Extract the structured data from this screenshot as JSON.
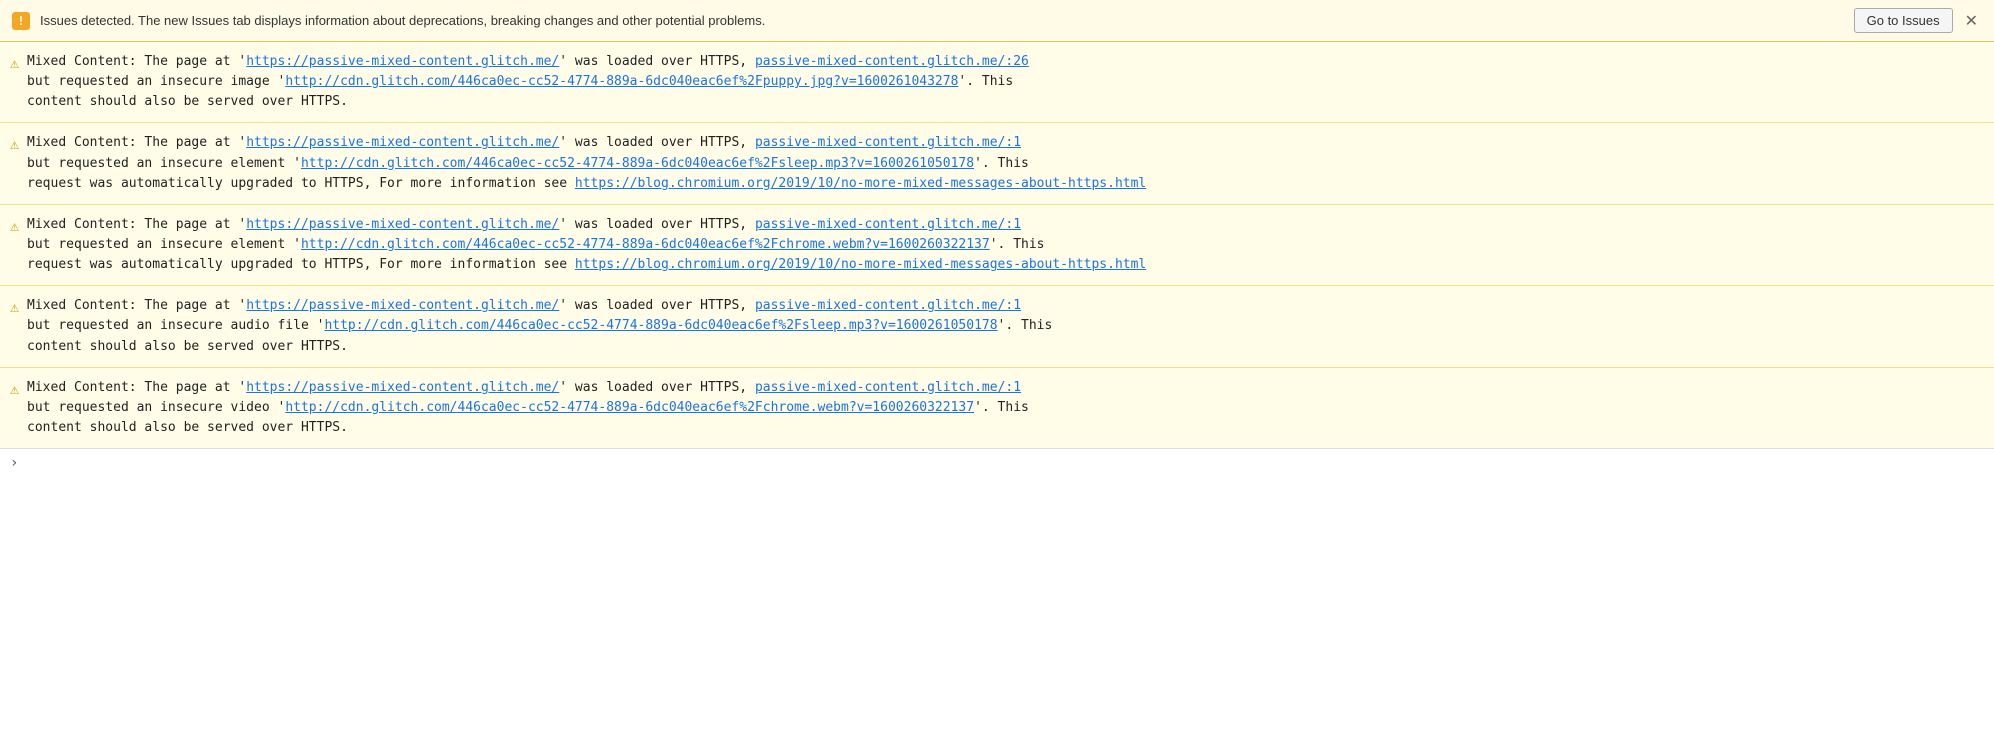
{
  "banner": {
    "icon": "!",
    "text": "Issues detected. The new Issues tab displays information about deprecations, breaking changes and other potential problems.",
    "go_to_issues_label": "Go to Issues",
    "close_label": "✕"
  },
  "messages": [
    {
      "id": 1,
      "parts": [
        {
          "type": "text",
          "value": "Mixed Content: The page at '"
        },
        {
          "type": "link",
          "value": "https://passive-mixed-content.glitch.me/",
          "href": "https://passive-mixed-content.glitch.me/"
        },
        {
          "type": "text",
          "value": "' was loaded over HTTPS,    "
        },
        {
          "type": "link",
          "value": "passive-mixed-content.glitch.me/:26",
          "href": "#"
        },
        {
          "type": "text",
          "value": "\nbut requested an insecure image '"
        },
        {
          "type": "link",
          "value": "http://cdn.glitch.com/446ca0ec-cc52-4774-889a-6dc040eac6ef%2Fpuppy.jpg?v=1600261043278",
          "href": "#"
        },
        {
          "type": "text",
          "value": "'. This\ncontent should also be served over HTTPS."
        }
      ]
    },
    {
      "id": 2,
      "parts": [
        {
          "type": "text",
          "value": "Mixed Content: The page at '"
        },
        {
          "type": "link",
          "value": "https://passive-mixed-content.glitch.me/",
          "href": "https://passive-mixed-content.glitch.me/"
        },
        {
          "type": "text",
          "value": "' was loaded over HTTPS,    "
        },
        {
          "type": "link",
          "value": "passive-mixed-content.glitch.me/:1",
          "href": "#"
        },
        {
          "type": "text",
          "value": "\nbut requested an insecure element '"
        },
        {
          "type": "link",
          "value": "http://cdn.glitch.com/446ca0ec-cc52-4774-889a-6dc040eac6ef%2Fsleep.mp3?v=1600261050178",
          "href": "#"
        },
        {
          "type": "text",
          "value": "'. This\nrequest was automatically upgraded to HTTPS, For more information see "
        },
        {
          "type": "link",
          "value": "https://blog.chromium.org/2019/10/no-more-mixed-messages-about-https.html",
          "href": "#"
        }
      ]
    },
    {
      "id": 3,
      "parts": [
        {
          "type": "text",
          "value": "Mixed Content: The page at '"
        },
        {
          "type": "link",
          "value": "https://passive-mixed-content.glitch.me/",
          "href": "https://passive-mixed-content.glitch.me/"
        },
        {
          "type": "text",
          "value": "' was loaded over HTTPS,    "
        },
        {
          "type": "link",
          "value": "passive-mixed-content.glitch.me/:1",
          "href": "#"
        },
        {
          "type": "text",
          "value": "\nbut requested an insecure element '"
        },
        {
          "type": "link",
          "value": "http://cdn.glitch.com/446ca0ec-cc52-4774-889a-6dc040eac6ef%2Fchrome.webm?v=1600260322137",
          "href": "#"
        },
        {
          "type": "text",
          "value": "'. This\nrequest was automatically upgraded to HTTPS, For more information see "
        },
        {
          "type": "link",
          "value": "https://blog.chromium.org/2019/10/no-more-mixed-messages-about-https.html",
          "href": "#"
        }
      ]
    },
    {
      "id": 4,
      "parts": [
        {
          "type": "text",
          "value": "Mixed Content: The page at '"
        },
        {
          "type": "link",
          "value": "https://passive-mixed-content.glitch.me/",
          "href": "https://passive-mixed-content.glitch.me/"
        },
        {
          "type": "text",
          "value": "' was loaded over HTTPS,    "
        },
        {
          "type": "link",
          "value": "passive-mixed-content.glitch.me/:1",
          "href": "#"
        },
        {
          "type": "text",
          "value": "\nbut requested an insecure audio file '"
        },
        {
          "type": "link",
          "value": "http://cdn.glitch.com/446ca0ec-cc52-4774-889a-6dc040eac6ef%2Fsleep.mp3?v=1600261050178",
          "href": "#"
        },
        {
          "type": "text",
          "value": "'. This\ncontent should also be served over HTTPS."
        }
      ]
    },
    {
      "id": 5,
      "parts": [
        {
          "type": "text",
          "value": "Mixed Content: The page at '"
        },
        {
          "type": "link",
          "value": "https://passive-mixed-content.glitch.me/",
          "href": "https://passive-mixed-content.glitch.me/"
        },
        {
          "type": "text",
          "value": "' was loaded over HTTPS,    "
        },
        {
          "type": "link",
          "value": "passive-mixed-content.glitch.me/:1",
          "href": "#"
        },
        {
          "type": "text",
          "value": "\nbut requested an insecure video '"
        },
        {
          "type": "link",
          "value": "http://cdn.glitch.com/446ca0ec-cc52-4774-889a-6dc040eac6ef%2Fchrome.webm?v=1600260322137",
          "href": "#"
        },
        {
          "type": "text",
          "value": "'. This\ncontent should also be served over HTTPS."
        }
      ]
    }
  ],
  "bottom_bar": {
    "chevron": "›"
  }
}
